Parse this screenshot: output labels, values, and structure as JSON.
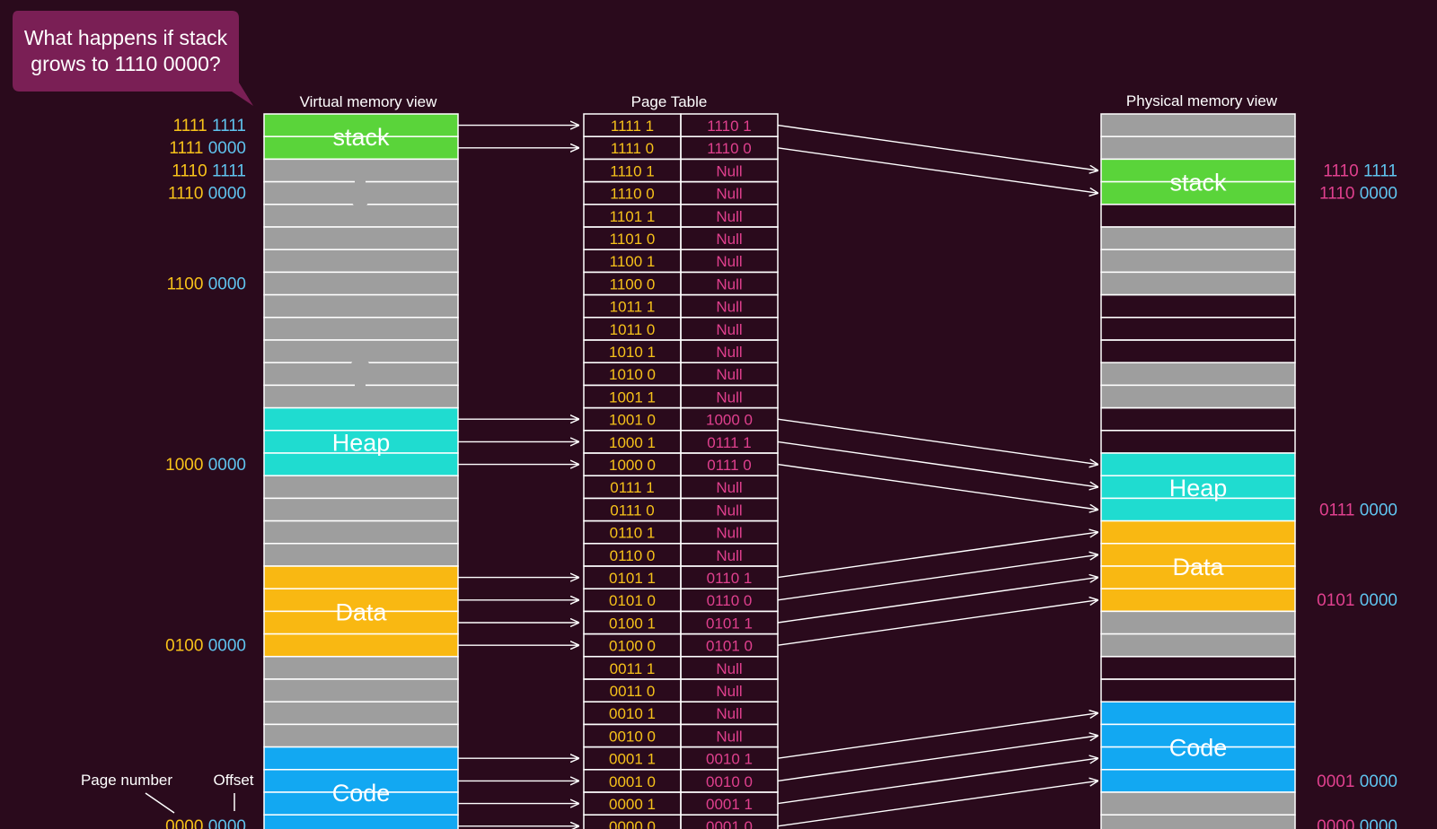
{
  "colors": {
    "background": "#2a0a1c",
    "callout": "#7a1f55",
    "stack": "#5ad43a",
    "heap": "#1fdcd0",
    "data": "#f9b812",
    "code": "#12a8f2",
    "free": "#9e9e9e",
    "page_num": "#f7c21a",
    "offset": "#5fc3ee",
    "physical": "#e0408e"
  },
  "callout": {
    "text": "What happens if stack grows to 1110 0000?"
  },
  "headers": {
    "virtual": "Virtual memory view",
    "page_table": "Page Table",
    "physical": "Physical memory view"
  },
  "segments": {
    "stack": "stack",
    "heap": "Heap",
    "data": "Data",
    "code": "Code"
  },
  "virtual_slots": [
    "stack",
    "stack",
    "free",
    "free",
    "free",
    "free",
    "free",
    "free",
    "free",
    "free",
    "free",
    "free",
    "free",
    "heap",
    "heap",
    "heap",
    "free",
    "free",
    "free",
    "free",
    "data",
    "data",
    "data",
    "data",
    "free",
    "free",
    "free",
    "free",
    "code",
    "code",
    "code",
    "code"
  ],
  "virtual_addresses": [
    {
      "row": 0,
      "page": "1111",
      "offset": "1111"
    },
    {
      "row": 1,
      "page": "1111",
      "offset": "0000"
    },
    {
      "row": 2,
      "page": "1110",
      "offset": "1111"
    },
    {
      "row": 3,
      "page": "1110",
      "offset": "0000"
    },
    {
      "row": 7,
      "page": "1100",
      "offset": "0000"
    },
    {
      "row": 15,
      "page": "1000",
      "offset": "0000"
    },
    {
      "row": 23,
      "page": "0100",
      "offset": "0000"
    },
    {
      "row": 31,
      "page": "0000",
      "offset": "0000"
    }
  ],
  "page_table": [
    [
      "1111 1",
      "1110 1"
    ],
    [
      "1111 0",
      "1110 0"
    ],
    [
      "1110 1",
      "Null"
    ],
    [
      "1110 0",
      "Null"
    ],
    [
      "1101 1",
      "Null"
    ],
    [
      "1101 0",
      "Null"
    ],
    [
      "1100 1",
      "Null"
    ],
    [
      "1100 0",
      "Null"
    ],
    [
      "1011 1",
      "Null"
    ],
    [
      "1011 0",
      "Null"
    ],
    [
      "1010 1",
      "Null"
    ],
    [
      "1010 0",
      "Null"
    ],
    [
      "1001 1",
      "Null"
    ],
    [
      "1001 0",
      "1000 0"
    ],
    [
      "1000 1",
      "0111 1"
    ],
    [
      "1000 0",
      "0111 0"
    ],
    [
      "0111 1",
      "Null"
    ],
    [
      "0111 0",
      "Null"
    ],
    [
      "0110 1",
      "Null"
    ],
    [
      "0110 0",
      "Null"
    ],
    [
      "0101 1",
      "0110 1"
    ],
    [
      "0101 0",
      "0110 0"
    ],
    [
      "0100 1",
      "0101 1"
    ],
    [
      "0100 0",
      "0101 0"
    ],
    [
      "0011 1",
      "Null"
    ],
    [
      "0011 0",
      "Null"
    ],
    [
      "0010 1",
      "Null"
    ],
    [
      "0010 0",
      "Null"
    ],
    [
      "0001 1",
      "0010 1"
    ],
    [
      "0001 0",
      "0010 0"
    ],
    [
      "0000 1",
      "0001 1"
    ],
    [
      "0000 0",
      "0001 0"
    ]
  ],
  "physical_slots": [
    "free",
    "free",
    "stack",
    "stack",
    "empty",
    "free",
    "free",
    "free",
    "empty",
    "empty",
    "empty",
    "free",
    "free",
    "empty",
    "empty",
    "heap",
    "heap",
    "heap",
    "data",
    "data",
    "data",
    "data",
    "free",
    "free",
    "empty",
    "empty",
    "code",
    "code",
    "code",
    "code",
    "free",
    "free"
  ],
  "physical_addresses": [
    {
      "row": 2,
      "page": "1110",
      "offset": "1111"
    },
    {
      "row": 3,
      "page": "1110",
      "offset": "0000"
    },
    {
      "row": 17,
      "page": "0111",
      "offset": "0000"
    },
    {
      "row": 21,
      "page": "0101",
      "offset": "0000"
    },
    {
      "row": 29,
      "page": "0001",
      "offset": "0000"
    },
    {
      "row": 31,
      "page": "0000",
      "offset": "0000"
    }
  ],
  "labels": {
    "page_number": "Page number",
    "offset": "Offset"
  }
}
